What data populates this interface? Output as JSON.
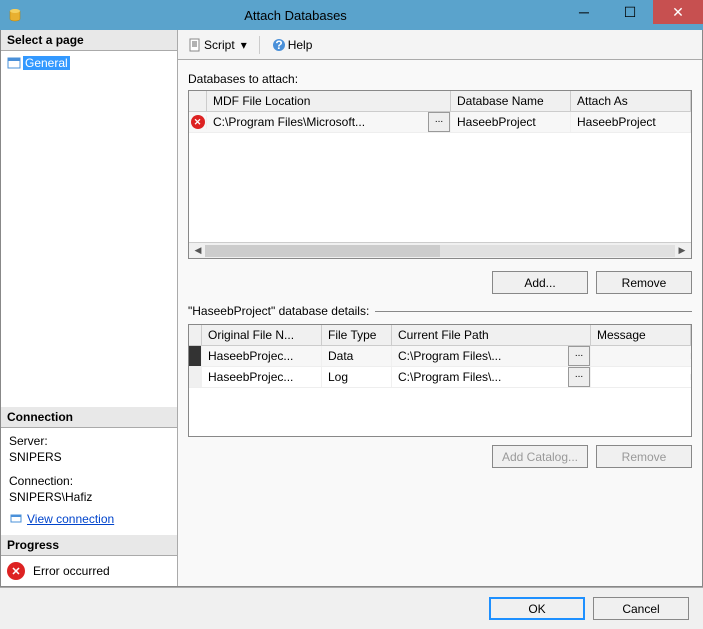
{
  "title": "Attach Databases",
  "sidebar": {
    "select_header": "Select a page",
    "page_general": "General",
    "connection_header": "Connection",
    "server_label": "Server:",
    "server_value": "SNIPERS",
    "conn_label": "Connection:",
    "conn_value": "SNIPERS\\Hafiz",
    "view_conn": "View connection",
    "progress_header": "Progress",
    "progress_status": "Error occurred"
  },
  "toolbar": {
    "script": "Script",
    "help": "Help"
  },
  "main": {
    "databases_label": "Databases to attach:",
    "grid1": {
      "headers": {
        "mdf": "MDF File Location",
        "dbname": "Database Name",
        "attach": "Attach As"
      },
      "row0": {
        "mdf": "C:\\Program Files\\Microsoft...",
        "dbname": "HaseebProject",
        "attach": "HaseebProject"
      }
    },
    "add": "Add...",
    "remove": "Remove",
    "details_label": "\"HaseebProject\" database details:",
    "grid2": {
      "headers": {
        "ofn": "Original File N...",
        "ft": "File Type",
        "cfp": "Current File Path",
        "msg": "Message"
      },
      "row0": {
        "ofn": "HaseebProjec...",
        "ft": "Data",
        "cfp": "C:\\Program Files\\..."
      },
      "row1": {
        "ofn": "HaseebProjec...",
        "ft": "Log",
        "cfp": "C:\\Program Files\\..."
      }
    },
    "add_catalog": "Add Catalog...",
    "remove2": "Remove"
  },
  "footer": {
    "ok": "OK",
    "cancel": "Cancel"
  }
}
